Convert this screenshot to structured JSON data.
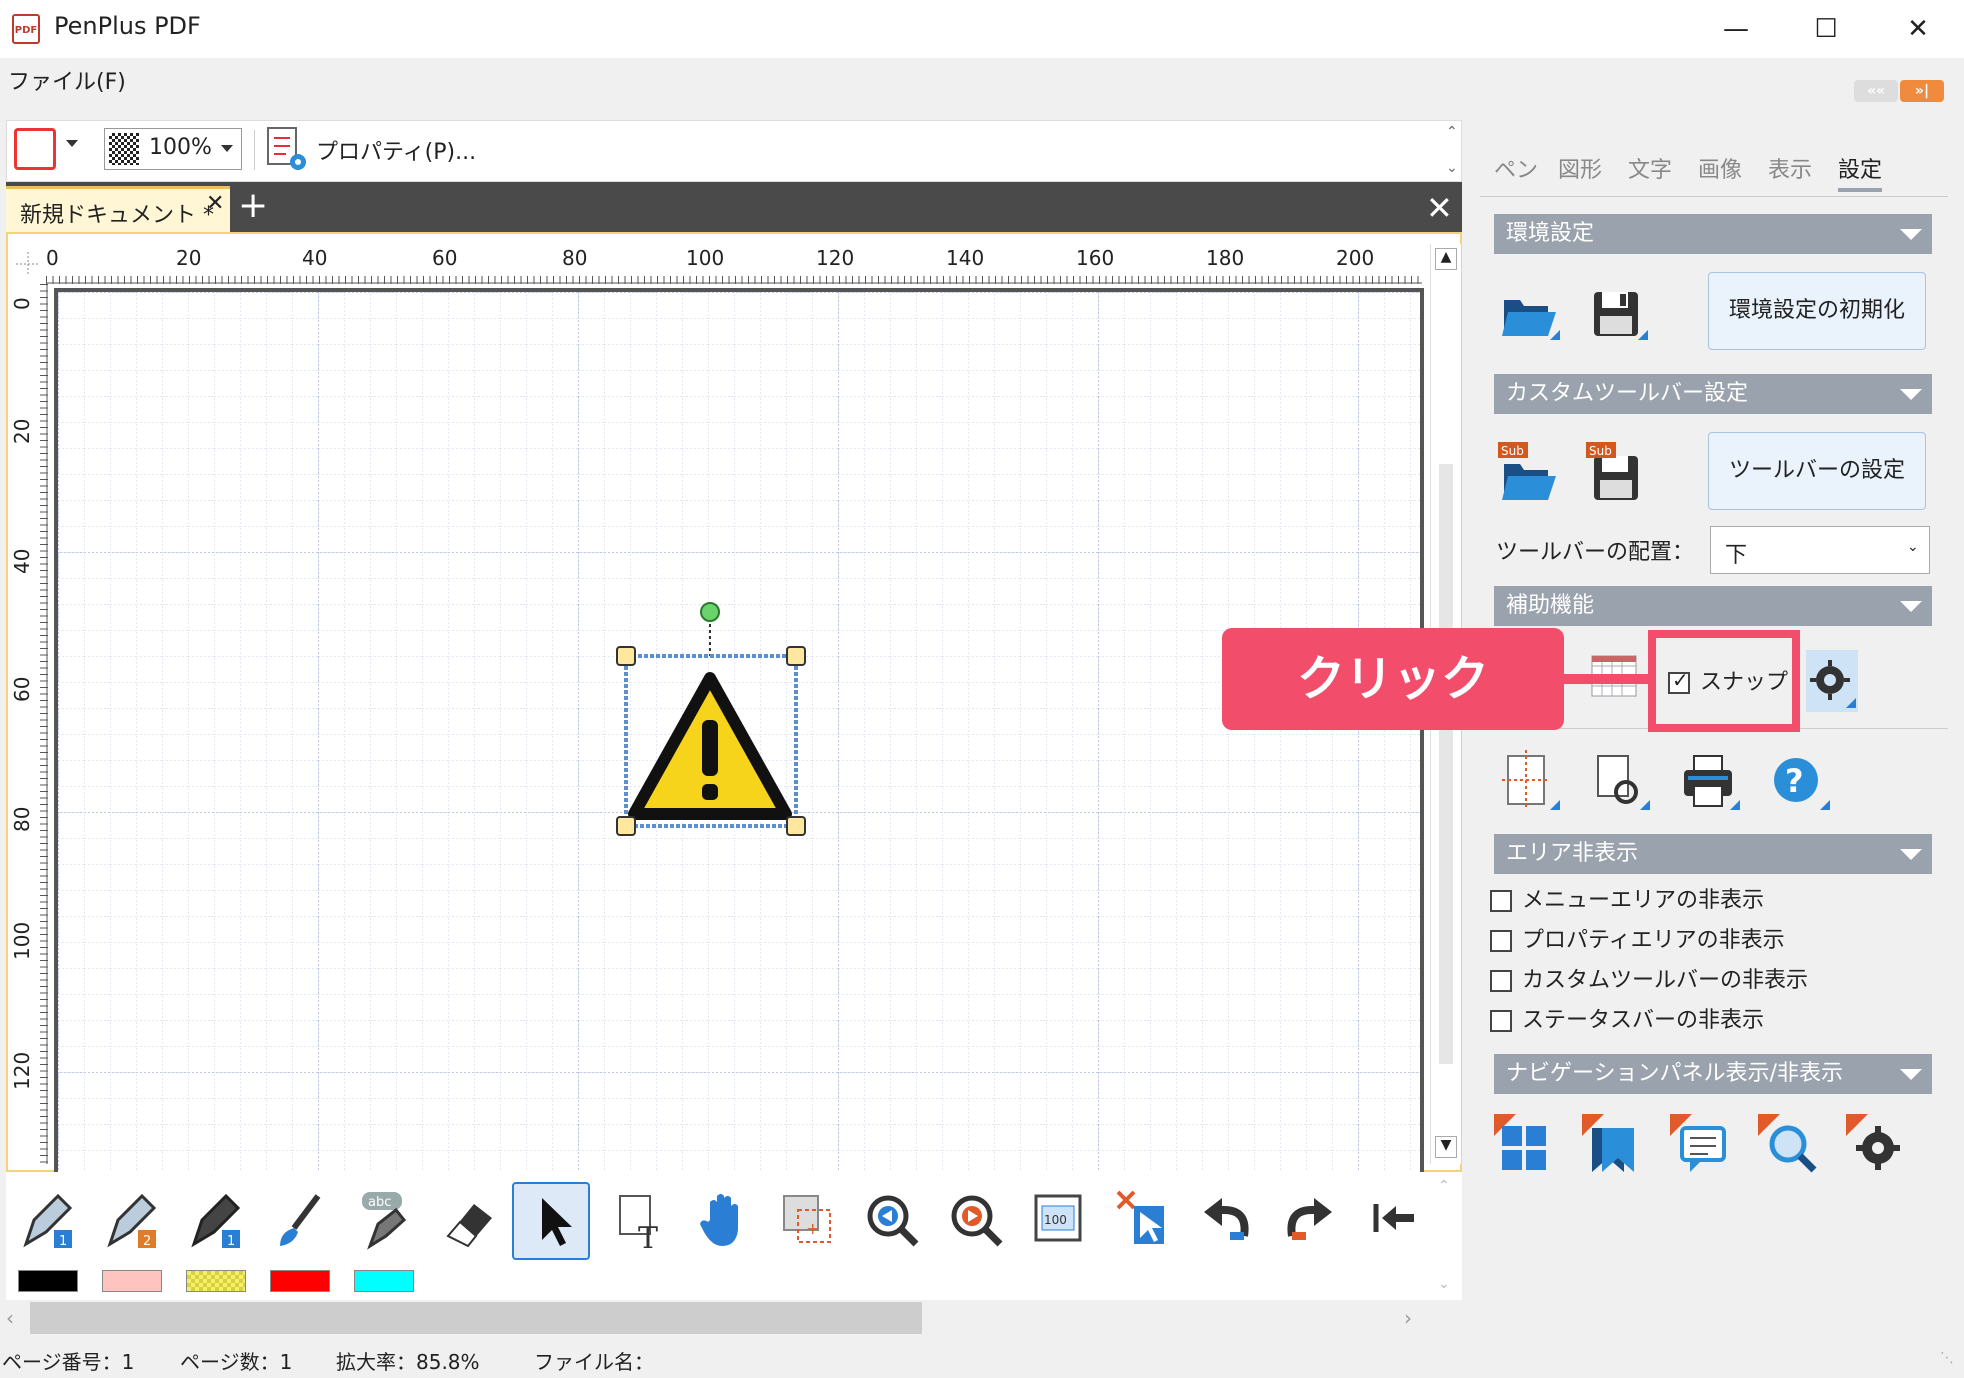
{
  "window": {
    "title": "PenPlus PDF",
    "app_icon_text": "PDF"
  },
  "menu": {
    "file": "ファイル(F)"
  },
  "toolbar_top": {
    "zoom": "100%",
    "properties_label": "プロパティ(P)..."
  },
  "document": {
    "tab_label": "新規ドキュメント *"
  },
  "ruler": {
    "top_labels": [
      "0",
      "20",
      "40",
      "60",
      "80",
      "100",
      "120",
      "140",
      "160",
      "180",
      "200"
    ],
    "left_labels": [
      "0",
      "20",
      "40",
      "60",
      "80",
      "100",
      "120"
    ]
  },
  "palette": {
    "colors": [
      "#000000",
      "#ffc4c0",
      "#f5f06a",
      "#ff0000",
      "#00ffff"
    ]
  },
  "status": {
    "page_number": "ページ番号：1",
    "page_count": "ページ数：1",
    "zoom": "拡大率：85.8%",
    "file_name": "ファイル名："
  },
  "panel": {
    "tabs": [
      "ペン",
      "図形",
      "文字",
      "画像",
      "表示",
      "設定"
    ],
    "active_tab": "設定",
    "env_header": "環境設定",
    "env_reset_button": "環境設定の初期化",
    "custom_toolbar_header": "カスタムツールバー設定",
    "toolbar_settings_button": "ツールバーの設定",
    "toolbar_position_label": "ツールバーの配置：",
    "toolbar_position_value": "下",
    "assist_header": "補助機能",
    "snap_label": "スナップ",
    "area_hide_header": "エリア非表示",
    "area_hide_options": [
      "メニューエリアの非表示",
      "プロパティエリアの非表示",
      "カスタムツールバーの非表示",
      "ステータスバーの非表示"
    ],
    "nav_panel_header": "ナビゲーションパネル表示/非表示",
    "sub_badge": "Sub"
  },
  "annotation": {
    "callout": "クリック"
  }
}
